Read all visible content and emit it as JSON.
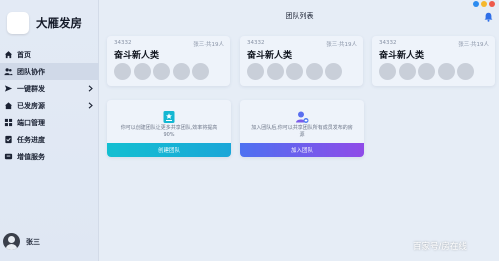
{
  "app": {
    "brand_name": "大雁发房"
  },
  "sidebar": {
    "items": [
      {
        "label": "首页",
        "icon": "home-icon"
      },
      {
        "label": "团队协作",
        "icon": "team-icon"
      },
      {
        "label": "一键群发",
        "icon": "send-icon"
      },
      {
        "label": "已发房源",
        "icon": "house-icon"
      },
      {
        "label": "端口管理",
        "icon": "grid-icon"
      },
      {
        "label": "任务进度",
        "icon": "task-icon"
      },
      {
        "label": "增值服务",
        "icon": "service-icon"
      }
    ],
    "active_index": 1
  },
  "user": {
    "name": "张三"
  },
  "header": {
    "title": "团队列表"
  },
  "teams": [
    {
      "id": "34332",
      "meta": "张三·共19人",
      "name": "奋斗新人类"
    },
    {
      "id": "34332",
      "meta": "张三·共19人",
      "name": "奋斗新人类"
    },
    {
      "id": "34332",
      "meta": "张三·共19人",
      "name": "奋斗新人类"
    }
  ],
  "actions": {
    "create": {
      "text": "你可以创建团队让更多共享团队,效率将提高90%",
      "button": "创建团队"
    },
    "join": {
      "text": "加入团队后,你可以共享团队所有成员发布的房源",
      "button": "加入团队"
    }
  },
  "watermark": "百家号/房在线",
  "colors": {
    "accent_create": "#13bfd1",
    "accent_join_start": "#4d71f1",
    "accent_join_end": "#8f4be8",
    "window_dot_blue": "#2d8cf0",
    "window_dot_yellow": "#f5b82e",
    "window_dot_red": "#ee5a4b"
  }
}
